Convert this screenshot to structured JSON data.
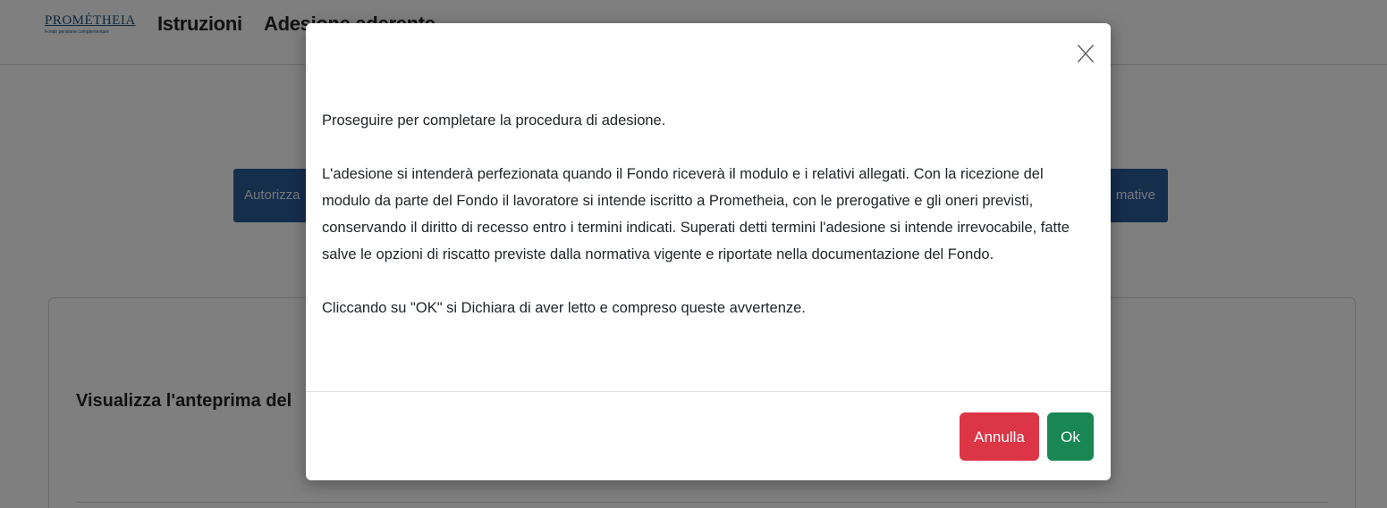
{
  "header": {
    "logo_text": "PROMÉTHEIA",
    "logo_subtext": "Fondo pensione complementare",
    "nav_istruzioni": "Istruzioni",
    "nav_adesione": "Adesione aderente"
  },
  "steps": {
    "left_label": "Autorizza",
    "right_label": "mative"
  },
  "card": {
    "title": "Visualizza l'anteprima del"
  },
  "modal": {
    "close_glyph": "X",
    "paragraph1": "Proseguire per completare la procedura di adesione.",
    "paragraph2": "L'adesione si intenderà perfezionata quando il Fondo riceverà il modulo e i relativi allegati. Con la ricezione del modulo da parte del Fondo il lavoratore si intende iscritto a Prometheia, con le prerogative e gli oneri previsti, conservando il diritto di recesso entro i termini indicati. Superati detti termini l'adesione si intende irrevocabile, fatte salve le opzioni di riscatto previste dalla normativa vigente e riportate nella documentazione del Fondo.",
    "paragraph3": "Cliccando su \"OK\" si Dichiara di aver letto e compreso queste avvertenze.",
    "cancel_label": "Annulla",
    "ok_label": "Ok"
  },
  "colors": {
    "brand_blue": "#2a5d98",
    "cancel_red": "#dc3545",
    "ok_green": "#198754"
  }
}
